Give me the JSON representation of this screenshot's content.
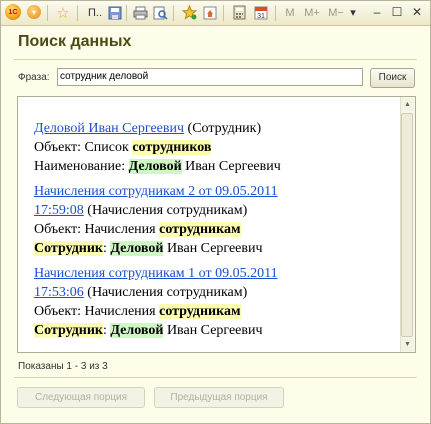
{
  "toolbar": {
    "logo_text": "1С",
    "truncated_menu": "П..",
    "m": "M",
    "m_plus": "M+",
    "m_minus": "M−",
    "dropdown_arrow": "▾",
    "minimize": "–",
    "maximize": "☐",
    "close": "✕"
  },
  "title": "Поиск данных",
  "search": {
    "label": "Фраза:",
    "value": "сотрудник деловой",
    "button_label": "Поиск"
  },
  "results": [
    {
      "link": "Деловой Иван Сергеевич",
      "type": "(Сотрудник)",
      "line2_prefix": "Объект: Список ",
      "line2_highlight": "сотрудников",
      "line3_prefix": "Наименование: ",
      "line3_highlight": "Деловой",
      "line3_suffix": " Иван Сергеевич"
    },
    {
      "link_line1": "Начисления сотрудникам 2 от 09.05.2011",
      "link_line2": "17:59:08",
      "type": " (Начисления сотрудникам)",
      "line2_prefix": "Объект: Начисления ",
      "line2_highlight": "сотрудникам",
      "line3_hl1": "Сотрудник",
      "line3_colon": ": ",
      "line3_hl2": "Деловой",
      "line3_suffix": " Иван Сергеевич"
    },
    {
      "link_line1": "Начисления сотрудникам 1 от 09.05.2011",
      "link_line2": "17:53:06",
      "type": " (Начисления сотрудникам)",
      "line2_prefix": "Объект: Начисления ",
      "line2_highlight": "сотрудникам",
      "line3_hl1": "Сотрудник",
      "line3_colon": ": ",
      "line3_hl2": "Деловой",
      "line3_suffix": " Иван Сергеевич"
    }
  ],
  "status": "Показаны 1 - 3 из 3",
  "buttons": {
    "next": "Следующая порция",
    "prev": "Предыдущая порция"
  },
  "colors": {
    "accent_title": "#4d4a12",
    "link": "#1a4fd4",
    "highlight_yellow": "#fbfbb1",
    "highlight_green": "#cff7c4"
  }
}
